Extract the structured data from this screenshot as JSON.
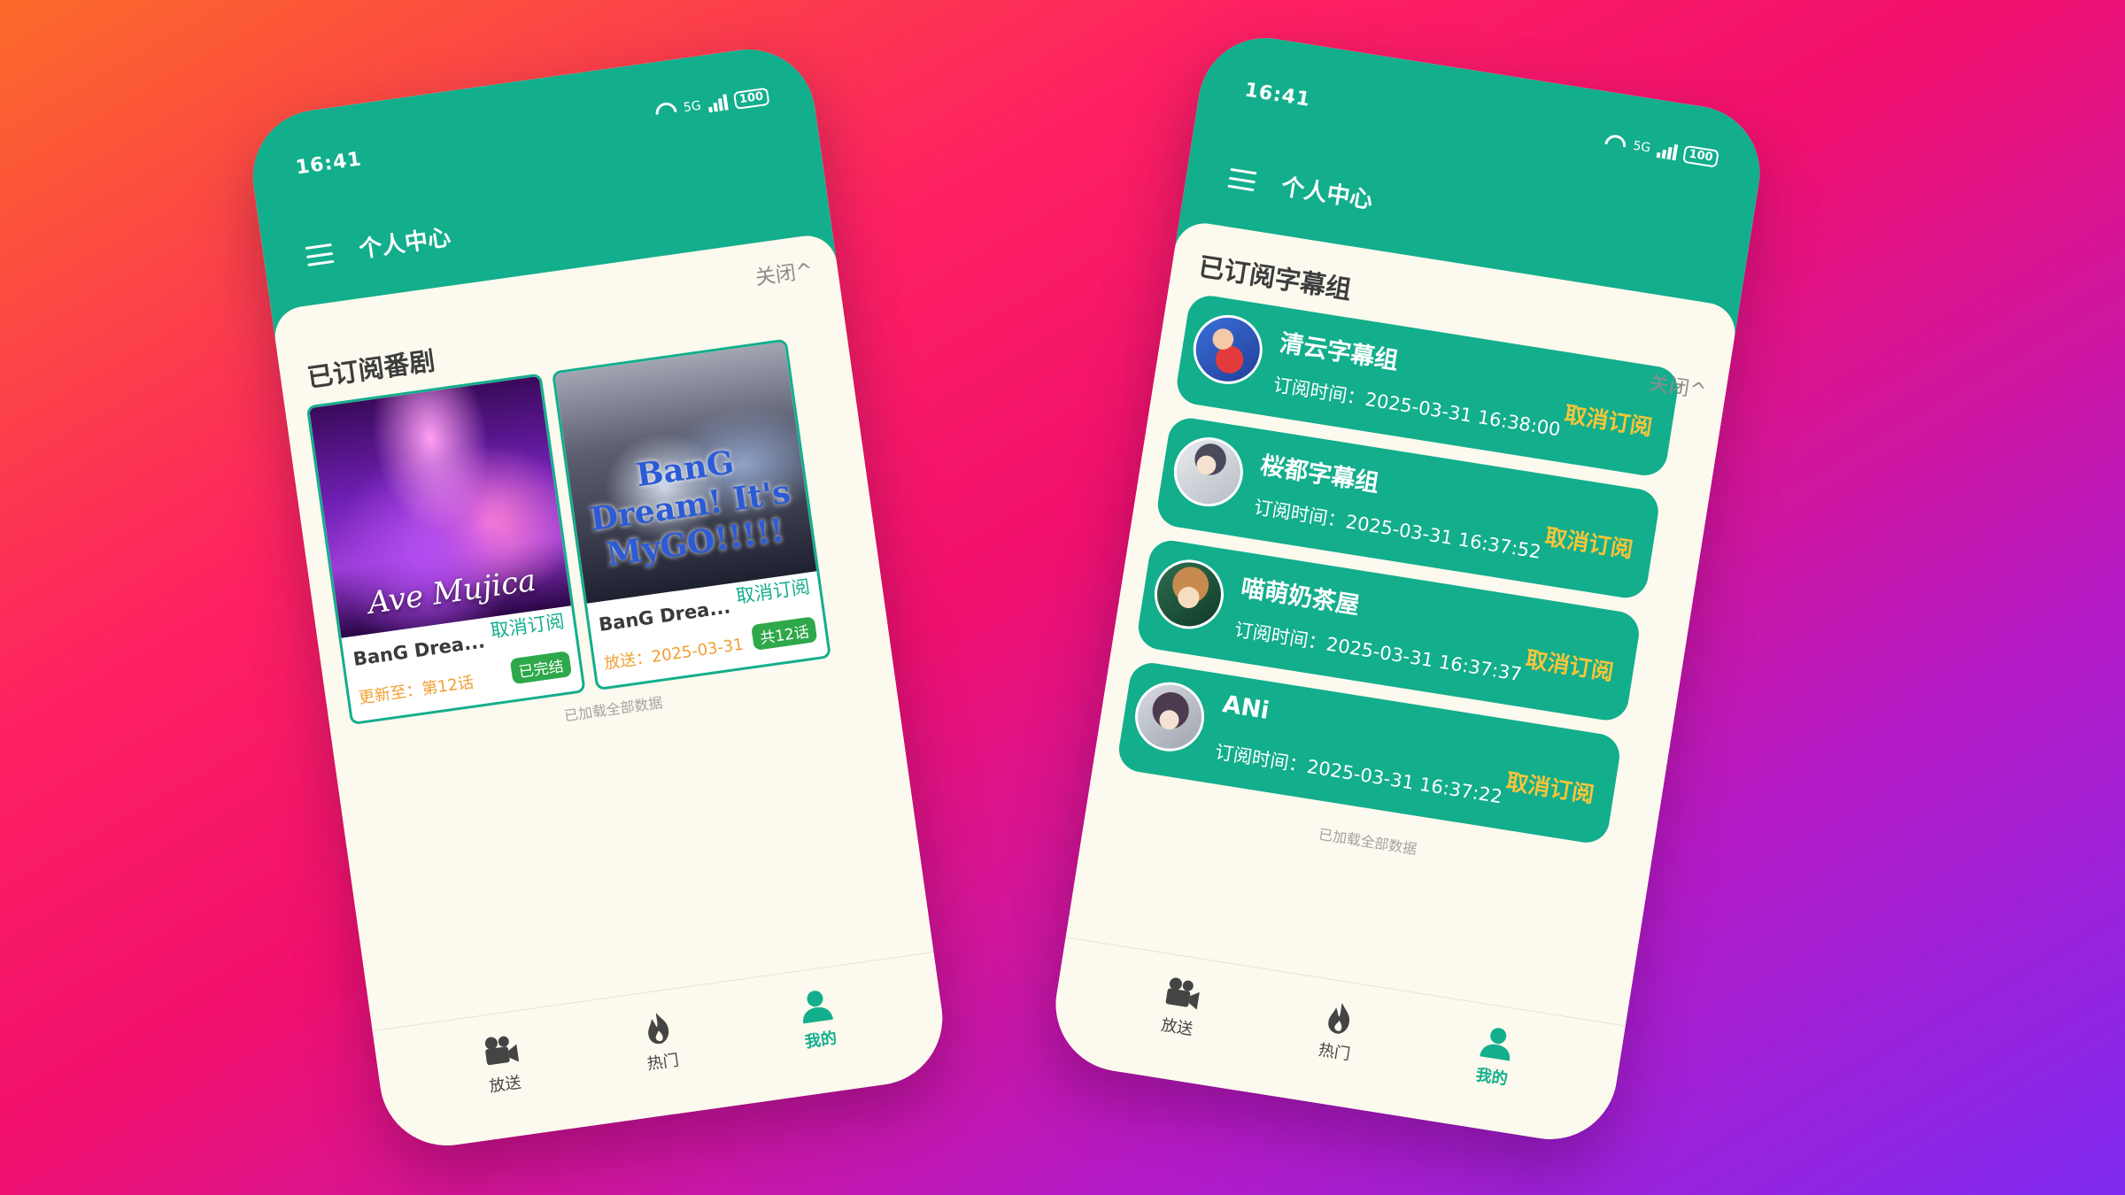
{
  "status_bar": {
    "time": "16:41",
    "network": "5G",
    "battery": "100"
  },
  "left_phone": {
    "app_title": "个人中心",
    "collapse_label": "关闭^",
    "section_title": "已订阅番剧",
    "cards": [
      {
        "cover_text": "Ave Mujica",
        "name": "BanG Drea...",
        "unsubscribe": "取消订阅",
        "meta": "更新至：第12话",
        "badge": "已完结"
      },
      {
        "cover_text": "BanG Dream! It's MyGO!!!!!",
        "name": "BanG Drea...",
        "unsubscribe": "取消订阅",
        "meta": "放送：2025-03-31",
        "badge": "共12话"
      }
    ],
    "loaded_note": "已加载全部数据"
  },
  "right_phone": {
    "app_title": "个人中心",
    "section_title": "已订阅字幕组",
    "collapse_label": "关闭^",
    "groups": [
      {
        "name": "清云字幕组",
        "time": "订阅时间：2025-03-31 16:38:00",
        "unsubscribe": "取消订阅"
      },
      {
        "name": "桜都字幕组",
        "time": "订阅时间：2025-03-31 16:37:52",
        "unsubscribe": "取消订阅"
      },
      {
        "name": "喵萌奶茶屋",
        "time": "订阅时间：2025-03-31 16:37:37",
        "unsubscribe": "取消订阅"
      },
      {
        "name": "ANi",
        "time": "订阅时间：2025-03-31 16:37:22",
        "unsubscribe": "取消订阅"
      }
    ],
    "loaded_note": "已加载全部数据"
  },
  "tabs": [
    {
      "label": "放送",
      "icon": "camera-icon"
    },
    {
      "label": "热门",
      "icon": "fire-icon"
    },
    {
      "label": "我的",
      "icon": "user-icon"
    }
  ],
  "active_tab": "我的",
  "colors": {
    "accent": "#13ae8c",
    "unsubscribe_yellow": "#f6c53a",
    "page_bg": "#fcf9ee",
    "meta_orange": "#f0a032",
    "badge_green": "#2ea84a"
  }
}
